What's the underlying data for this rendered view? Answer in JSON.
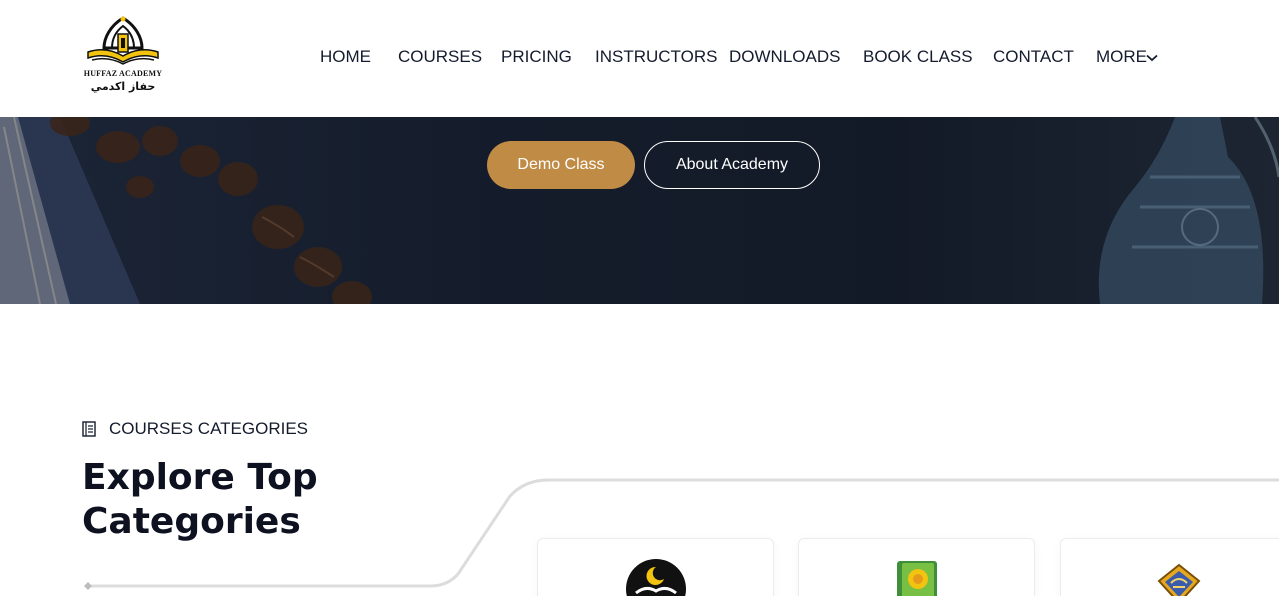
{
  "logo": {
    "name": "HUFFAZ ACADEMY",
    "arabic": "حفاز اكدمي"
  },
  "nav": {
    "items": [
      "HOME",
      "COURSES",
      "PRICING",
      "INSTRUCTORS",
      "DOWNLOADS",
      "BOOK CLASS",
      "CONTACT"
    ],
    "more": "MORE"
  },
  "hero": {
    "demo_label": "Demo Class",
    "about_label": "About Academy"
  },
  "categories": {
    "eyebrow": "COURSES CATEGORIES",
    "title": "Explore Top Categories",
    "cards": [
      {
        "icon": "quran-moon-icon"
      },
      {
        "icon": "quran-book-icon"
      },
      {
        "icon": "calligraphy-emblem-icon"
      }
    ]
  },
  "colors": {
    "accent": "#c08b45",
    "hero_bg": "#141c2b",
    "text_dark": "#141b2d"
  }
}
